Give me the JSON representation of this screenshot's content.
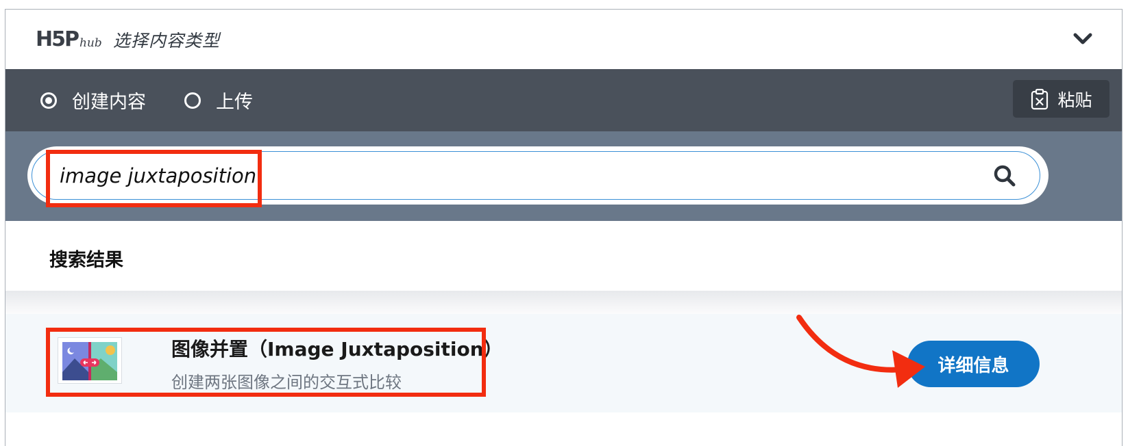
{
  "header": {
    "logo_main": "H5P",
    "logo_sub": "hub",
    "title": "选择内容类型",
    "collapse_icon": "chevron-down-icon"
  },
  "tabs": [
    {
      "label": "创建内容",
      "selected": true
    },
    {
      "label": "上传",
      "selected": false
    }
  ],
  "paste_button": {
    "label": "粘贴",
    "icon": "clipboard-icon"
  },
  "search": {
    "value": "image juxtaposition",
    "icon": "search-icon"
  },
  "results": {
    "heading": "搜索结果",
    "items": [
      {
        "title": "图像并置（Image Juxtaposition）",
        "description": "创建两张图像之间的交互式比较",
        "details_label": "详细信息",
        "icon": "image-juxtaposition-icon"
      }
    ]
  },
  "colors": {
    "tab_bar": "#4a515b",
    "search_band": "#69788a",
    "accent_button": "#1175c6",
    "annotation": "#f22d10"
  }
}
